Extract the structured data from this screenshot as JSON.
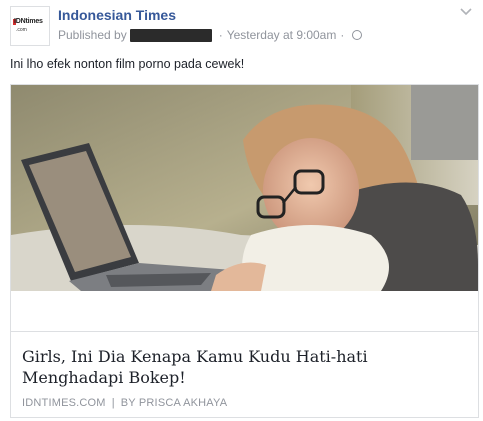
{
  "post": {
    "page_name": "Indonesian Times",
    "published_prefix": "Published by",
    "timestamp": "Yesterday at 9:00am",
    "meta_separator": "·",
    "audience_icon": "globe-icon",
    "message": "Ini lho efek nonton film porno pada cewek!"
  },
  "avatar": {
    "logo_text": "IDNtimes",
    "logo_sub": ".com"
  },
  "link_card": {
    "title": "Girls, Ini Dia Kenapa Kamu Kudu Hati-hati Menghadapi Bokep!",
    "domain": "IDNTIMES.COM",
    "separator": "|",
    "author": "BY PRISCA AKHAYA"
  },
  "colors": {
    "page_name": "#365899",
    "meta": "#90949c",
    "border": "#dddfe2"
  }
}
